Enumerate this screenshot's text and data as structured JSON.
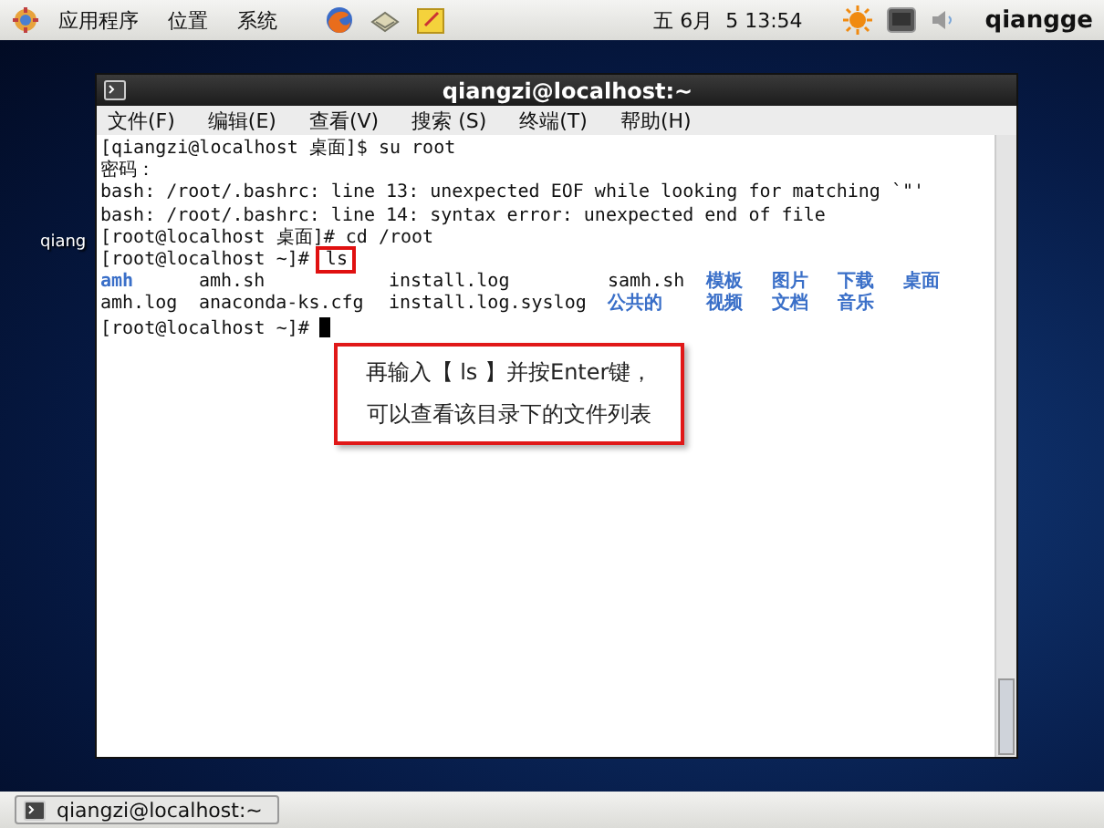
{
  "top_panel": {
    "menus": [
      "应用程序",
      "位置",
      "系统"
    ],
    "clock": "五 6月  5 13:54",
    "user": "qiangge"
  },
  "desktop_icon": {
    "label": "qiang"
  },
  "terminal": {
    "title": "qiangzi@localhost:~",
    "menu": [
      "文件(F)",
      "编辑(E)",
      "查看(V)",
      "搜索 (S)",
      "终端(T)",
      "帮助(H)"
    ],
    "lines": [
      {
        "kind": "command",
        "prompt": "[qiangzi@localhost 桌面]$",
        "command": "su root"
      },
      {
        "kind": "text",
        "text": "密码："
      },
      {
        "kind": "text",
        "text": "bash: /root/.bashrc: line 13: unexpected EOF while looking for matching `\"'"
      },
      {
        "kind": "text",
        "text": "bash: /root/.bashrc: line 14: syntax error: unexpected end of file"
      },
      {
        "kind": "command",
        "prompt": "[root@localhost 桌面]#",
        "command": "cd /root"
      },
      {
        "kind": "command",
        "prompt": "[root@localhost ~]#",
        "command": "ls",
        "boxed": true
      },
      {
        "kind": "listing",
        "entries": [
          {
            "name": "amh",
            "color": "#3a6fc8"
          },
          {
            "name": "amh.sh",
            "color": "#111111"
          },
          {
            "name": "install.log",
            "color": "#111111"
          },
          {
            "name": "samh.sh",
            "color": "#111111"
          },
          {
            "name": "模板",
            "color": "#3a6fc8"
          },
          {
            "name": "图片",
            "color": "#3a6fc8"
          },
          {
            "name": "下载",
            "color": "#3a6fc8"
          },
          {
            "name": "桌面",
            "color": "#3a6fc8"
          }
        ]
      },
      {
        "kind": "listing",
        "entries": [
          {
            "name": "amh.log",
            "color": "#111111"
          },
          {
            "name": "anaconda-ks.cfg",
            "color": "#111111"
          },
          {
            "name": "install.log.syslog",
            "color": "#111111"
          },
          {
            "name": "公共的",
            "color": "#3a6fc8"
          },
          {
            "name": "视频",
            "color": "#3a6fc8"
          },
          {
            "name": "文档",
            "color": "#3a6fc8"
          },
          {
            "name": "音乐",
            "color": "#3a6fc8"
          }
        ]
      },
      {
        "kind": "command",
        "prompt": "[root@localhost ~]#",
        "cursor": true
      }
    ]
  },
  "callout": {
    "lines": [
      "再输入【 ls 】并按Enter键，",
      "可以查看该目录下的文件列表"
    ]
  },
  "taskbar": {
    "buttons": [
      {
        "label": "qiangzi@localhost:~",
        "selected": false
      }
    ]
  }
}
